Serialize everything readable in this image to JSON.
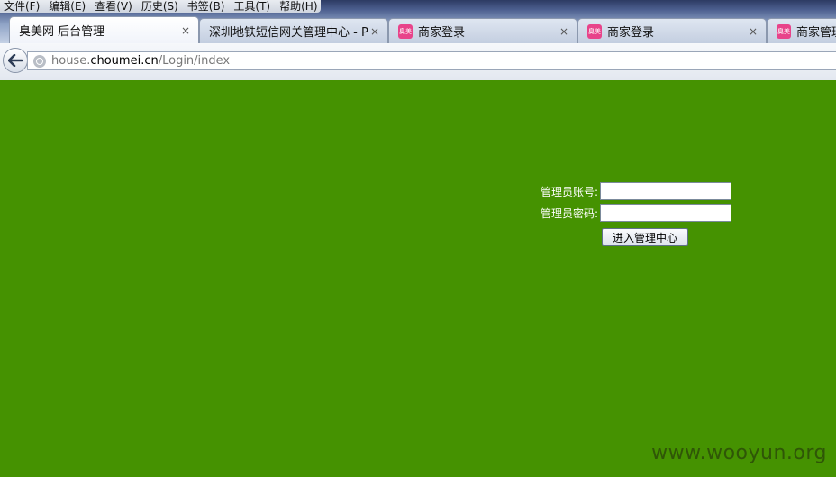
{
  "menubar": {
    "items": [
      "文件(F)",
      "编辑(E)",
      "查看(V)",
      "历史(S)",
      "书签(B)",
      "工具(T)",
      "帮助(H)"
    ]
  },
  "tabs": [
    {
      "label": "臭美网 后台管理",
      "favicon": "",
      "active": true
    },
    {
      "label": "深圳地铁短信网关管理中心 - P...",
      "favicon": "",
      "active": false
    },
    {
      "label": "商家登录",
      "favicon": "臭美",
      "active": false
    },
    {
      "label": "商家登录",
      "favicon": "臭美",
      "active": false
    },
    {
      "label": "商家管理",
      "favicon": "臭美",
      "active": false
    }
  ],
  "tab_close_glyph": "×",
  "address": {
    "prefix": "house.",
    "domain": "choumei.cn",
    "path": "/Login/index"
  },
  "login": {
    "account_label": "管理员账号:",
    "account_value": "",
    "password_label": "管理员密码:",
    "password_value": "",
    "submit_label": "进入管理中心"
  },
  "watermark": "www.wooyun.org",
  "colors": {
    "page_background": "#459201",
    "favicon": "#e8438a"
  }
}
